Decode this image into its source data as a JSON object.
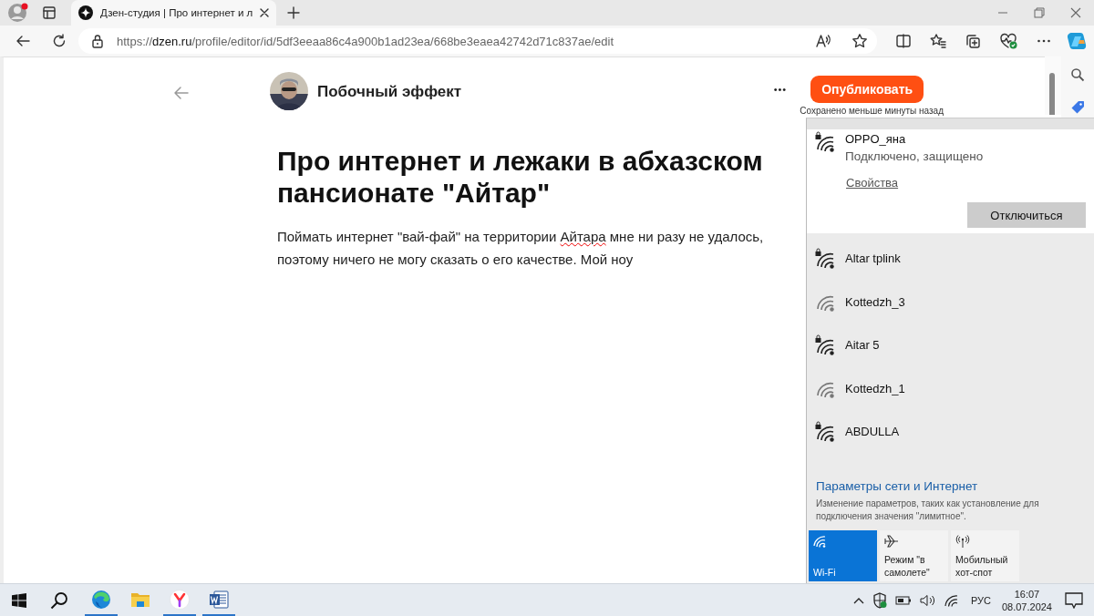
{
  "browser": {
    "tab": {
      "title": "Дзен-студия | Про интернет и л",
      "selected": true
    },
    "url": {
      "prefix": "https://",
      "host": "dzen.ru",
      "path": "/profile/editor/id/5df3eeaa86c4a900b1ad23ea/668be3eaea42742d71c837ae/edit"
    }
  },
  "editor": {
    "author": "Побочный эффект",
    "more": "•••",
    "publish_button": "Опубликовать",
    "save_status": "Сохранено меньше минуты назад",
    "title": "Про интернет и лежаки в абхазском пансионате \"Айтар\"",
    "paragraph": [
      {
        "text": "Поймать интернет \"вай-фай\" на территории ",
        "misspelled": false
      },
      {
        "text": "Айтара",
        "misspelled": true
      },
      {
        "text": " мне ни разу не удалось, поэтому ничего не могу сказать о его качестве. Мой ноу",
        "misspelled": false
      }
    ]
  },
  "wifi_flyout": {
    "connected": {
      "name": "OPPO_яна",
      "status": "Подключено, защищено",
      "properties_link": "Свойства",
      "disconnect_button": "Отключиться",
      "secured": true
    },
    "networks": [
      {
        "name": "Altar tplink",
        "secured": true
      },
      {
        "name": "Kottedzh_3",
        "secured": false
      },
      {
        "name": "Aitar 5",
        "secured": true
      },
      {
        "name": "Kottedzh_1",
        "secured": false
      },
      {
        "name": "ABDULLA",
        "secured": true
      }
    ],
    "settings_link": "Параметры сети и Интернет",
    "settings_hint": "Изменение параметров, таких как установление для подключения значения \"лимитное\".",
    "tiles": [
      {
        "kind": "wifi",
        "label": "Wi-Fi",
        "selected": true
      },
      {
        "kind": "airplane",
        "label": "Режим \"в самолете\"",
        "selected": false
      },
      {
        "kind": "hotspot",
        "label": "Мобильный хот-спот",
        "selected": false
      }
    ]
  },
  "taskbar": {
    "apps": [
      {
        "kind": "edge",
        "running": true
      },
      {
        "kind": "explorer",
        "running": false
      },
      {
        "kind": "yandex",
        "running": true
      },
      {
        "kind": "word",
        "running": true
      }
    ],
    "language": "РУС",
    "time": "16:07",
    "date": "08.07.2024"
  }
}
